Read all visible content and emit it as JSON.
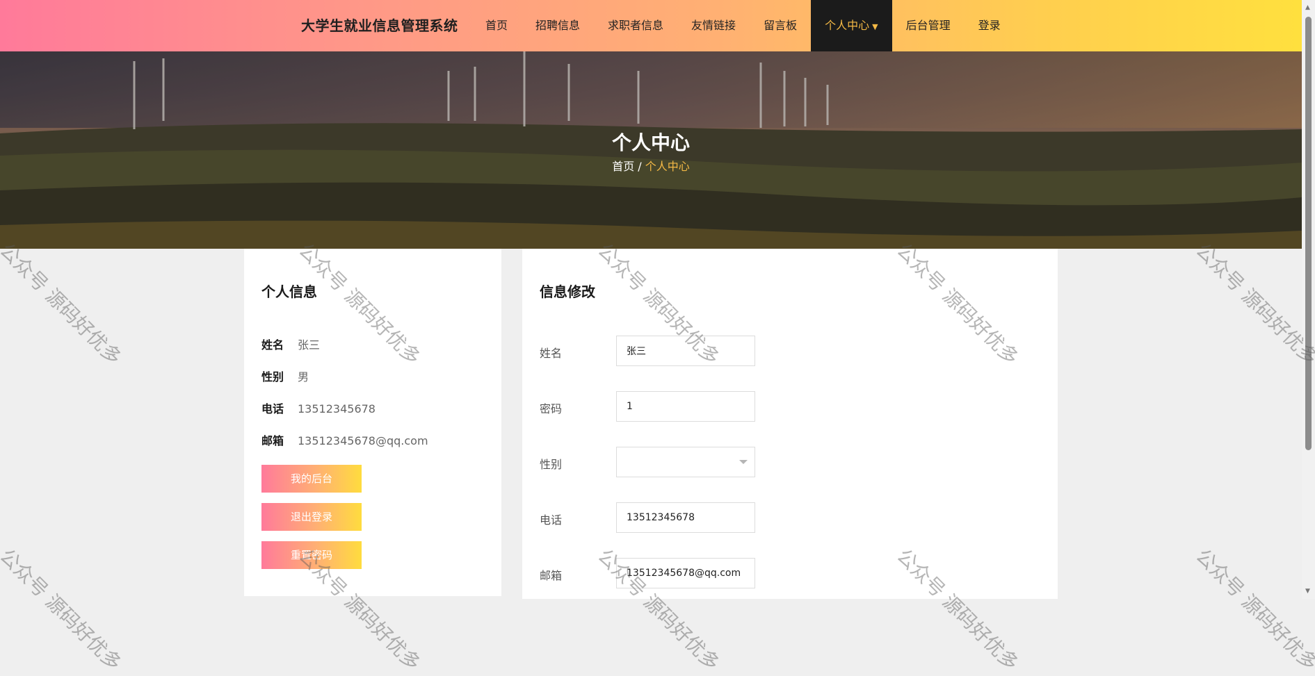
{
  "header": {
    "brand": "大学生就业信息管理系统",
    "nav": [
      {
        "label": "首页"
      },
      {
        "label": "招聘信息"
      },
      {
        "label": "求职者信息"
      },
      {
        "label": "友情链接"
      },
      {
        "label": "留言板"
      },
      {
        "label": "个人中心",
        "active": true
      },
      {
        "label": "后台管理"
      },
      {
        "label": "登录"
      }
    ],
    "dropdown_icon": "chevron-down-icon",
    "gradient_colors": [
      "#ff7a9a",
      "#ffb073",
      "#ffe03e"
    ],
    "active_color": "#f5b945"
  },
  "banner": {
    "title": "个人中心",
    "breadcrumb": {
      "home": "首页",
      "separator": " / ",
      "current": "个人中心"
    }
  },
  "profile": {
    "title": "个人信息",
    "fields": [
      {
        "label": "姓名",
        "value": "张三"
      },
      {
        "label": "性别",
        "value": "男"
      },
      {
        "label": "电话",
        "value": "13512345678"
      },
      {
        "label": "邮箱",
        "value": "13512345678@qq.com"
      }
    ],
    "buttons": [
      {
        "label": "我的后台"
      },
      {
        "label": "退出登录"
      },
      {
        "label": "重置密码"
      }
    ]
  },
  "edit_form": {
    "title": "信息修改",
    "fields": [
      {
        "label": "姓名",
        "value": "张三"
      },
      {
        "label": "密码",
        "value": "1"
      },
      {
        "label": "性别",
        "value": ""
      },
      {
        "label": "电话",
        "value": "13512345678"
      },
      {
        "label": "邮箱",
        "value": "13512345678@qq.com"
      }
    ]
  },
  "watermark": {
    "text": "公众号 源码好优多"
  }
}
